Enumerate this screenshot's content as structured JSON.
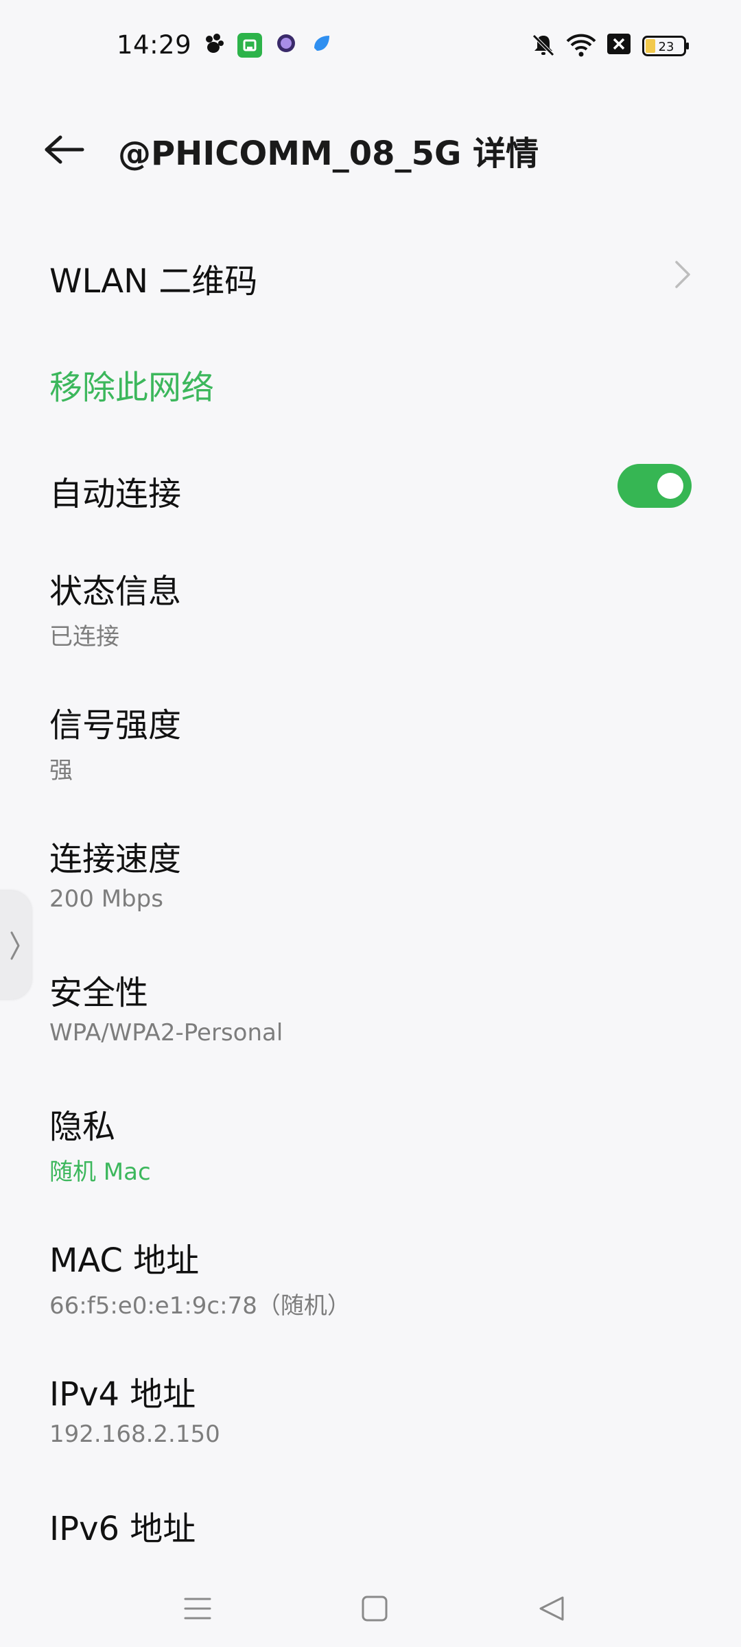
{
  "status_bar": {
    "time": "14:29",
    "battery_level": "23",
    "icons": [
      "paw-app-icon",
      "green-store-icon",
      "purple-circle-app-icon",
      "blue-app-icon",
      "mute-icon",
      "wifi-icon",
      "no-sim-icon",
      "battery-icon"
    ]
  },
  "header": {
    "title": "@PHICOMM_08_5G 详情",
    "back_icon": "back-arrow-icon"
  },
  "items": {
    "wlan_qr": {
      "label": "WLAN 二维码"
    },
    "remove_network": {
      "label": "移除此网络"
    },
    "auto_connect": {
      "label": "自动连接",
      "enabled": true
    },
    "status": {
      "label": "状态信息",
      "value": "已连接"
    },
    "signal": {
      "label": "信号强度",
      "value": "强"
    },
    "speed": {
      "label": "连接速度",
      "value": "200 Mbps"
    },
    "security": {
      "label": "安全性",
      "value": "WPA/WPA2-Personal"
    },
    "privacy": {
      "label": "隐私",
      "value": "随机 Mac"
    },
    "mac": {
      "label": "MAC 地址",
      "value": "66:f5:e0:e1:9c:78（随机）"
    },
    "ipv4": {
      "label": "IPv4 地址",
      "value": "192.168.2.150"
    },
    "ipv6": {
      "label": "IPv6 地址"
    }
  },
  "colors": {
    "accent_green": "#3cb75c",
    "toggle_on": "#36b653",
    "background": "#f7f7f9",
    "secondary_text": "#7d7d7d"
  },
  "nav_bar": {
    "icons": [
      "menu-icon",
      "home-icon",
      "back-triangle-icon"
    ]
  }
}
